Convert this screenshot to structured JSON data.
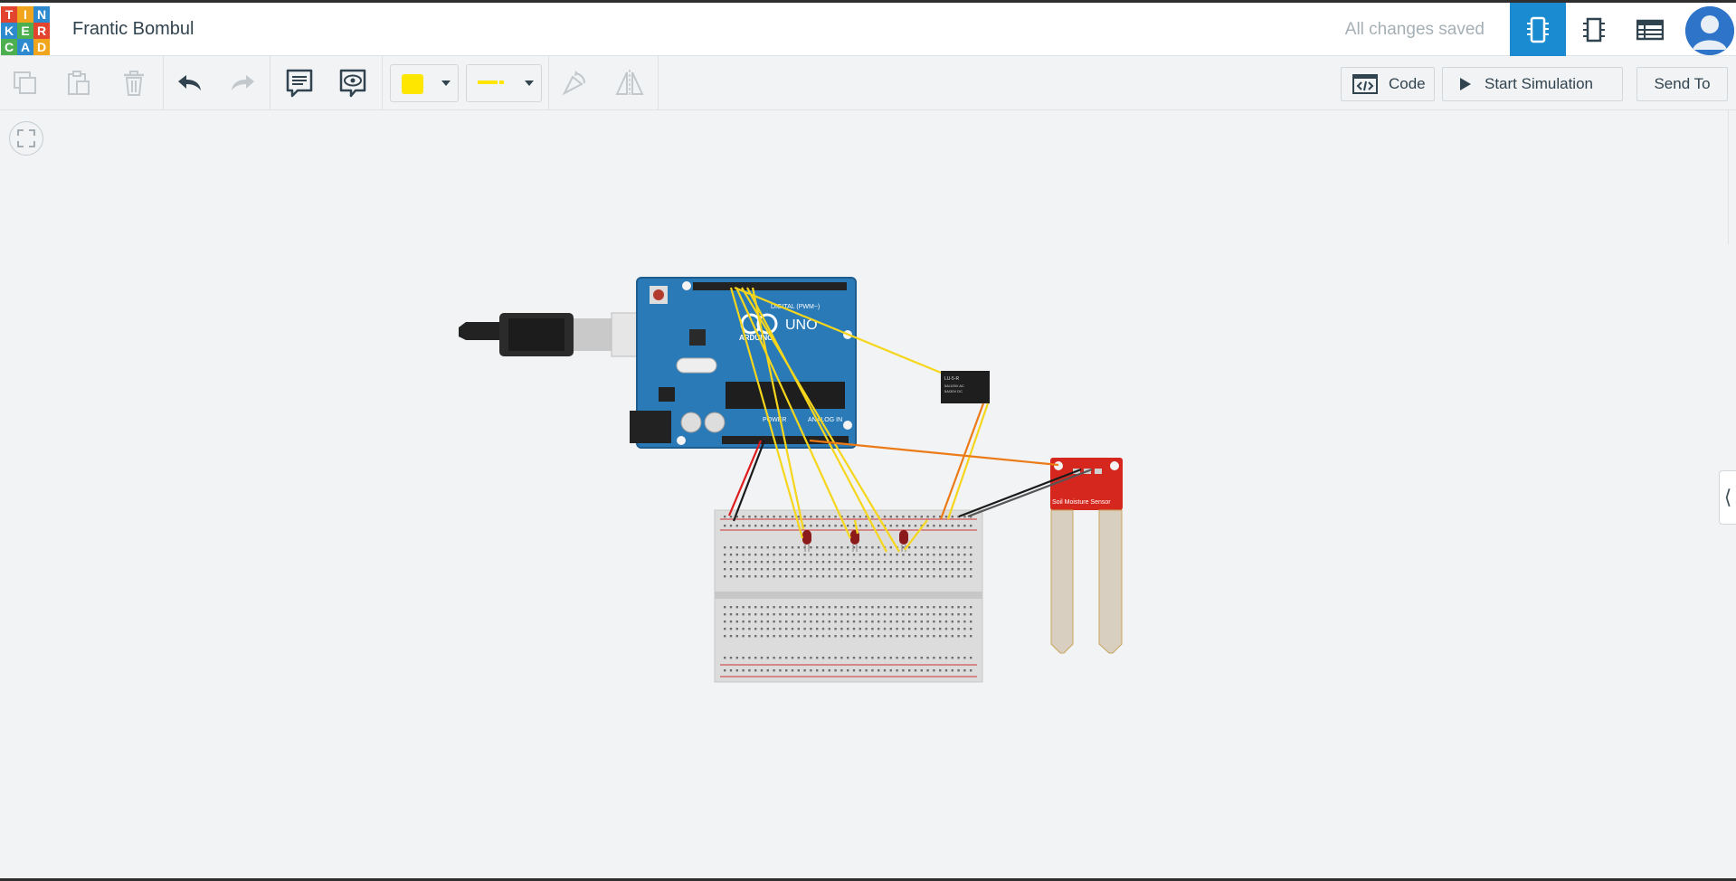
{
  "app": {
    "logo_letters": [
      "T",
      "I",
      "N",
      "K",
      "E",
      "R",
      "C",
      "A",
      "D"
    ],
    "logo_colors": [
      "#e2442f",
      "#f0a51d",
      "#2d8acf",
      "#2d8acf",
      "#4caf50",
      "#e2442f",
      "#4caf50",
      "#2d8acf",
      "#f0a51d"
    ],
    "project_title": "Frantic Bombul",
    "save_status": "All changes saved"
  },
  "views": [
    {
      "name": "circuit-view-icon",
      "active": true
    },
    {
      "name": "schematic-view-icon",
      "active": false
    },
    {
      "name": "component-list-icon",
      "active": false
    }
  ],
  "toolbar": {
    "tools": [
      "copy-icon",
      "paste-icon",
      "delete-icon",
      "undo-icon",
      "redo-icon",
      "notes-icon",
      "notes-visibility-icon",
      "rotate-icon",
      "flip-icon"
    ],
    "wire_color": "#ffe600",
    "wire_style": "solid",
    "code_label": "Code",
    "start_simulation_label": "Start Simulation",
    "send_to_label": "Send To"
  },
  "canvas": {
    "components": [
      "Arduino Uno R3",
      "USB cable",
      "Breadboard small",
      "Red LED 1",
      "Red LED 2",
      "Red LED 3",
      "Relay module",
      "Soil Moisture Sensor"
    ],
    "arduino_labels": {
      "brand": "ARDUINO",
      "model": "UNO",
      "digital": "DIGITAL (PWM~)",
      "power": "POWER",
      "analog": "ANALOG IN"
    },
    "relay_labels": [
      "LU-5-R",
      "5A/125V AC",
      "5A/30V DC"
    ],
    "sensor_label": "Soil Moisture Sensor",
    "wire_colors": {
      "signal": "#f6d61c",
      "ground": "#1a1a1a",
      "power": "#e01b1b",
      "analog": "#ec7a16"
    }
  }
}
